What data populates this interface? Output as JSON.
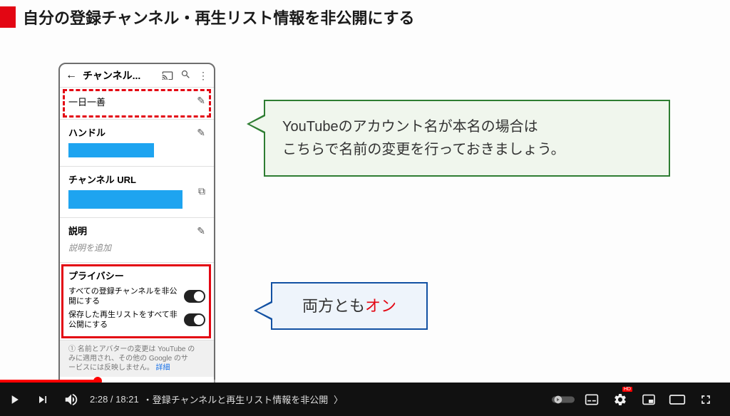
{
  "title": "自分の登録チャンネル・再生リスト情報を非公開にする",
  "phone": {
    "header_title": "チャンネル...",
    "name_row": {
      "text": "一日一善"
    },
    "handle": {
      "label": "ハンドル"
    },
    "url": {
      "label": "チャンネル URL"
    },
    "desc": {
      "label": "説明",
      "hint": "説明を追加"
    },
    "privacy": {
      "label": "プライバシー",
      "item1": "すべての登録チャンネルを非公開にする",
      "item2": "保存した再生リストをすべて非公開にする"
    },
    "footer_line1": "① 名前とアバターの変更は YouTube の",
    "footer_line2": "みに適用され、その他の Google のサ",
    "footer_line3": "ービスには反映しません。",
    "footer_link": "詳細"
  },
  "callouts": {
    "green_l1": "YouTubeのアカウント名が本名の場合は",
    "green_l2": "こちらで名前の変更を行っておきましょう。",
    "blue_text": "両方とも",
    "blue_on": "オン"
  },
  "player": {
    "time": "2:28 / 18:21",
    "chapter_sep": "・",
    "chapter": "登録チャンネルと再生リスト情報を非公開",
    "chevron": "〉"
  }
}
